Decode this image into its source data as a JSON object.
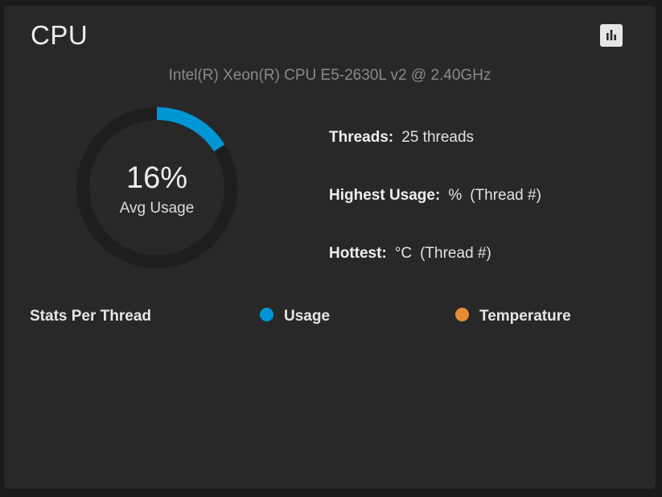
{
  "card": {
    "title": "CPU",
    "report_icon": "bar-chart-icon",
    "cpu_model": "Intel(R) Xeon(R) CPU E5-2630L v2 @ 2.40GHz"
  },
  "gauge": {
    "value_label": "16%",
    "value_fraction": 0.16,
    "caption": "Avg Usage",
    "track_color": "#1e1e1e",
    "fill_color": "#0095d5"
  },
  "stats": {
    "threads": {
      "label": "Threads:",
      "value": "25 threads"
    },
    "highest": {
      "label": "Highest Usage:",
      "value": "%",
      "detail": "(Thread #)"
    },
    "hottest": {
      "label": "Hottest:",
      "value": "°C",
      "detail": "(Thread #)"
    }
  },
  "legend": {
    "title": "Stats Per Thread",
    "items": [
      {
        "label": "Usage",
        "color": "#0095d5"
      },
      {
        "label": "Temperature",
        "color": "#e68d36"
      }
    ]
  }
}
